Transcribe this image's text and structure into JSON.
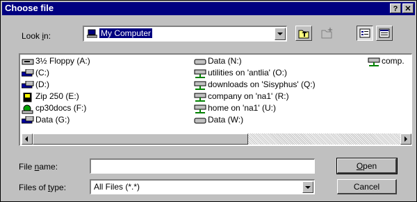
{
  "window": {
    "title": "Choose file",
    "help_label": "?",
    "close_label": "✕"
  },
  "lookin": {
    "label_pre": "Look ",
    "label_key": "i",
    "label_post": "n:",
    "value": "My Computer"
  },
  "toolbar": {
    "up_icon": "up-folder-icon",
    "newfolder_icon": "new-folder-icon",
    "list_icon": "list-view-icon",
    "details_icon": "details-view-icon"
  },
  "files": {
    "col1": [
      {
        "label": "3½ Floppy (A:)",
        "icon": "floppy-drive-icon"
      },
      {
        "label": "(C:)",
        "icon": "hard-drive-icon"
      },
      {
        "label": "(D:)",
        "icon": "hard-drive-icon"
      },
      {
        "label": "Zip 250 (E:)",
        "icon": "zip-drive-icon"
      },
      {
        "label": "cp30docs (F:)",
        "icon": "shared-drive-icon"
      },
      {
        "label": "Data (G:)",
        "icon": "hard-drive-icon"
      }
    ],
    "col2": [
      {
        "label": "Data (N:)",
        "icon": "drive-icon"
      },
      {
        "label": "utilities on 'antlia' (O:)",
        "icon": "network-drive-icon"
      },
      {
        "label": "downloads on 'Sisyphus' (Q:)",
        "icon": "network-drive-icon"
      },
      {
        "label": "company on 'na1' (R:)",
        "icon": "network-drive-icon"
      },
      {
        "label": "home on 'na1' (U:)",
        "icon": "network-drive-icon"
      },
      {
        "label": "Data (W:)",
        "icon": "drive-icon"
      }
    ],
    "col3": [
      {
        "label": "comp.",
        "icon": "network-drive-icon"
      }
    ]
  },
  "filename": {
    "label_pre": "File ",
    "label_key": "n",
    "label_post": "ame:",
    "value": ""
  },
  "filetype": {
    "label_pre": "Files of ",
    "label_key": "t",
    "label_post": "ype:",
    "value": "All Files (*.*)"
  },
  "buttons": {
    "open_key": "O",
    "open_rest": "pen",
    "cancel": "Cancel"
  },
  "colors": {
    "title_bar": "#000080",
    "face": "#c0c0c0",
    "selection": "#000080"
  }
}
